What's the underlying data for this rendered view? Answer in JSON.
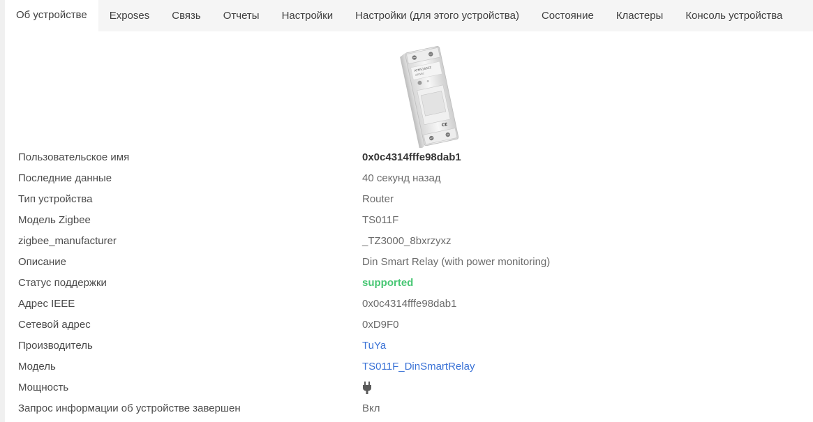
{
  "tabs": [
    {
      "label": "Об устройстве",
      "active": true
    },
    {
      "label": "Exposes"
    },
    {
      "label": "Связь"
    },
    {
      "label": "Отчеты"
    },
    {
      "label": "Настройки"
    },
    {
      "label": "Настройки (для этого устройства)"
    },
    {
      "label": "Состояние"
    },
    {
      "label": "Кластеры"
    },
    {
      "label": "Консоль устройства"
    }
  ],
  "device_image": {
    "front_text_1": "ATMS1602Z",
    "front_text_2": "230VAC",
    "ce_mark": "CE"
  },
  "info": {
    "friendly_name": {
      "label": "Пользовательское имя",
      "value": "0x0c4314fffe98dab1"
    },
    "last_seen": {
      "label": "Последние данные",
      "value": "40 секунд назад"
    },
    "device_type": {
      "label": "Тип устройства",
      "value": "Router"
    },
    "zigbee_model": {
      "label": "Модель Zigbee",
      "value": "TS011F"
    },
    "zigbee_manufacturer": {
      "label": "zigbee_manufacturer",
      "value": "_TZ3000_8bxrzyxz"
    },
    "description": {
      "label": "Описание",
      "value": "Din Smart Relay (with power monitoring)"
    },
    "support_status": {
      "label": "Статус поддержки",
      "value": "supported"
    },
    "ieee_address": {
      "label": "Адрес IEEE",
      "value": "0x0c4314fffe98dab1"
    },
    "network_address": {
      "label": "Сетевой адрес",
      "value": "0xD9F0"
    },
    "manufacturer": {
      "label": "Производитель",
      "value": "TuYa"
    },
    "model": {
      "label": "Модель",
      "value": "TS011F_DinSmartRelay"
    },
    "power": {
      "label": "Мощность",
      "icon": "plug-icon"
    },
    "interview_completed": {
      "label": "Запрос информации об устройстве завершен",
      "value": "Вкл"
    }
  },
  "colors": {
    "supported": "#48c774",
    "link": "#3a72d6"
  }
}
